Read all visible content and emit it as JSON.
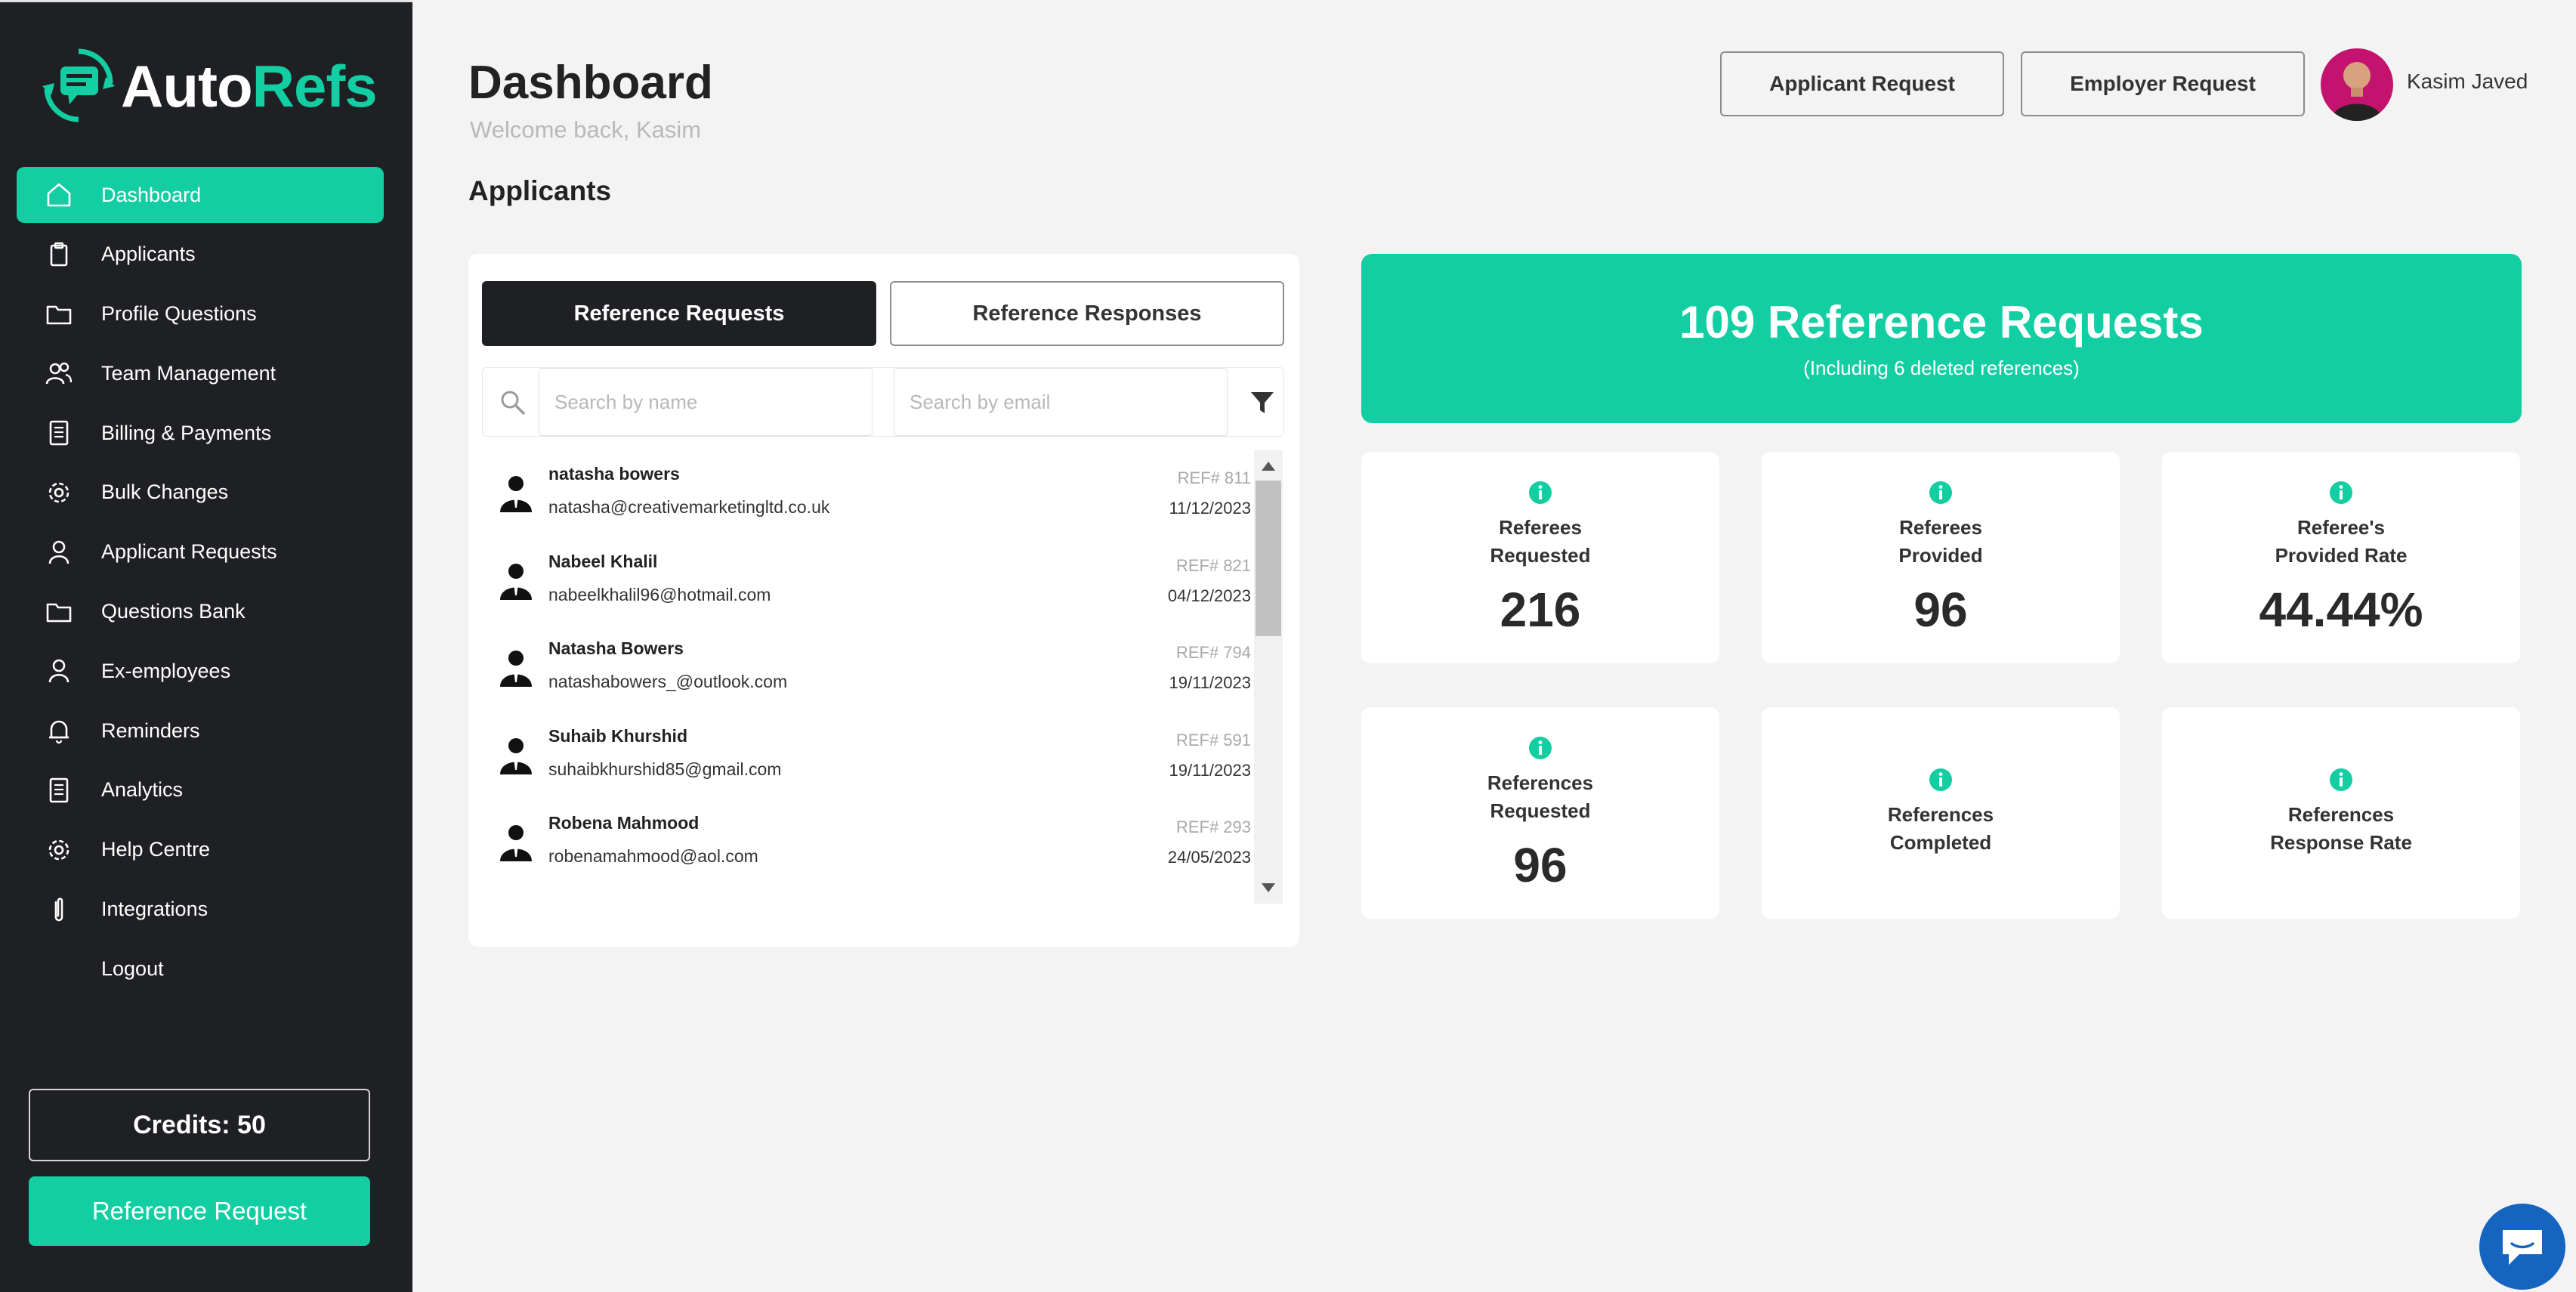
{
  "brand": {
    "part1": "Auto",
    "part2": "Refs",
    "accent": "#12cea2"
  },
  "sidebar": {
    "items": [
      {
        "label": "Dashboard",
        "icon": "home-icon"
      },
      {
        "label": "Applicants",
        "icon": "clipboard-icon"
      },
      {
        "label": "Profile Questions",
        "icon": "folder-icon"
      },
      {
        "label": "Team Management",
        "icon": "users-icon"
      },
      {
        "label": "Billing & Payments",
        "icon": "document-icon"
      },
      {
        "label": "Bulk Changes",
        "icon": "gear-icon"
      },
      {
        "label": "Applicant Requests",
        "icon": "user-icon"
      },
      {
        "label": "Questions Bank",
        "icon": "folder-icon"
      },
      {
        "label": "Ex-employees",
        "icon": "user-icon"
      },
      {
        "label": "Reminders",
        "icon": "bell-icon"
      },
      {
        "label": "Analytics",
        "icon": "document-icon"
      },
      {
        "label": "Help Centre",
        "icon": "gear-icon"
      },
      {
        "label": "Integrations",
        "icon": "paperclip-icon"
      },
      {
        "label": "Logout",
        "icon": ""
      }
    ],
    "credits": "Credits: 50",
    "reference_request_button": "Reference Request"
  },
  "header": {
    "title": "Dashboard",
    "welcome": "Welcome back, Kasim",
    "applicant_request_button": "Applicant Request",
    "employer_request_button": "Employer Request",
    "user_name": "Kasim Javed"
  },
  "section_title": "Applicants",
  "panel": {
    "tabs": [
      "Reference Requests",
      "Reference Responses"
    ],
    "search_name_placeholder": "Search by name",
    "search_email_placeholder": "Search by email",
    "rows": [
      {
        "name": "natasha bowers",
        "email": "natasha@creativemarketingltd.co.uk",
        "ref": "REF# 811",
        "date": "11/12/2023"
      },
      {
        "name": "Nabeel Khalil",
        "email": "nabeelkhalil96@hotmail.com",
        "ref": "REF# 821",
        "date": "04/12/2023"
      },
      {
        "name": "Natasha Bowers",
        "email": "natashabowers_@outlook.com",
        "ref": "REF# 794",
        "date": "19/11/2023"
      },
      {
        "name": "Suhaib Khurshid",
        "email": "suhaibkhurshid85@gmail.com",
        "ref": "REF# 591",
        "date": "19/11/2023"
      },
      {
        "name": "Robena Mahmood",
        "email": "robenamahmood@aol.com",
        "ref": "REF# 293",
        "date": "24/05/2023"
      }
    ]
  },
  "stats": {
    "banner_title": "109 Reference Requests",
    "banner_subtitle": "(Including 6 deleted references)",
    "cards": [
      {
        "label_line1": "Referees",
        "label_line2": "Requested",
        "value": "216"
      },
      {
        "label_line1": "Referees",
        "label_line2": "Provided",
        "value": "96"
      },
      {
        "label_line1": "Referee's",
        "label_line2": "Provided Rate",
        "value": "44.44%"
      },
      {
        "label_line1": "References",
        "label_line2": "Requested",
        "value": "96"
      },
      {
        "label_line1": "References",
        "label_line2": "Completed",
        "value": ""
      },
      {
        "label_line1": "References",
        "label_line2": "Response Rate",
        "value": ""
      }
    ]
  }
}
